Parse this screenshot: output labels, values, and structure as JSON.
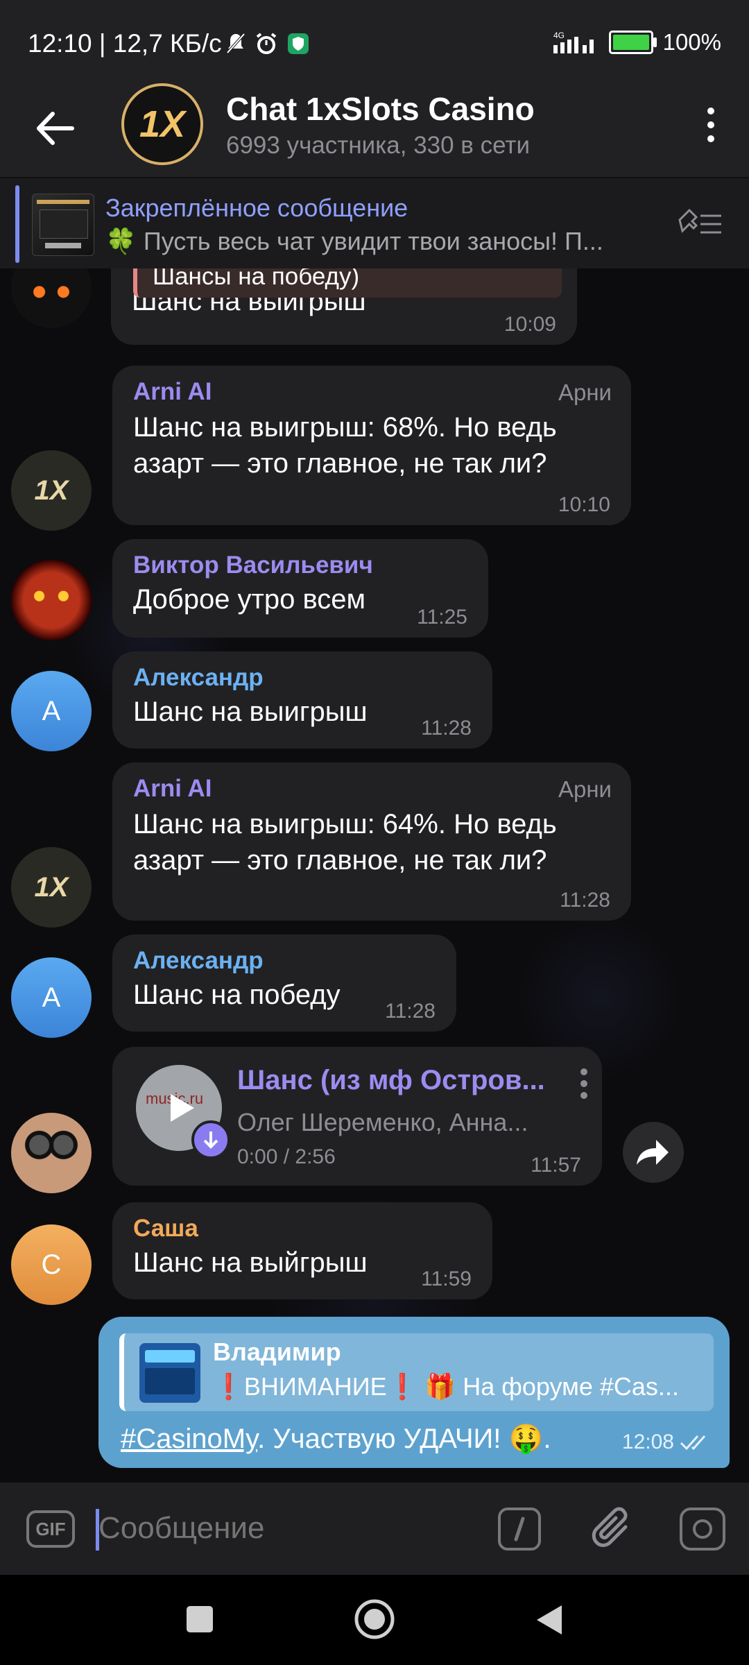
{
  "status": {
    "time": "12:10 | 12,7 КБ/с",
    "network": "4G",
    "battery": "100%"
  },
  "header": {
    "title": "Chat 1xSlots Casino",
    "subtitle": "6993 участника, 330 в сети",
    "avatar_text": "1X"
  },
  "pinned": {
    "title": "Закреплённое сообщение",
    "text": "🍀 Пусть весь чат увидит твои заносы! П..."
  },
  "messages": [
    {
      "reply_fragment": "Шансы на победу)",
      "text": "Шанс на выигрыш",
      "time": "10:09"
    },
    {
      "author": "Arni AI",
      "rank": "Арни",
      "text_line1": "Шанс на выигрыш: 68%. Но ведь",
      "text_line2": "азарт — это главное, не так ли?",
      "time": "10:10"
    },
    {
      "author": "Виктор Васильевич",
      "text": "Доброе утро всем",
      "time": "11:25"
    },
    {
      "author": "Александр",
      "avatar_letter": "A",
      "text": "Шанс на выигрыш",
      "time": "11:28"
    },
    {
      "author": "Arni AI",
      "rank": "Арни",
      "text_line1": "Шанс на выигрыш: 64%. Но ведь",
      "text_line2": "азарт — это главное, не так ли?",
      "time": "11:28"
    },
    {
      "author": "Александр",
      "avatar_letter": "A",
      "text": "Шанс на победу",
      "time": "11:28"
    },
    {
      "audio_title": "Шанс (из мф Остров...",
      "audio_artist": "Олег Шеременко, Анна...",
      "audio_progress": "0:00 / 2:56",
      "thumb_text": "music.ru",
      "time": "11:57"
    },
    {
      "author": "Саша",
      "avatar_letter": "С",
      "text": "Шанс на выйгрыш",
      "time": "11:59"
    }
  ],
  "own_message": {
    "quote_author": "Владимир",
    "quote_text": "❗ВНИМАНИЕ❗ 🎁 На форуме #Cas...",
    "hashtag": "#CasinoMy",
    "text": ". Участвую УДАЧИ! 🤑.",
    "time": "12:08"
  },
  "composer": {
    "placeholder": "Сообщение",
    "gif_label": "GIF"
  },
  "colors": {
    "accent": "#7b8cf0",
    "own_bubble": "#5da2cf",
    "name_violet": "#9b8cf0",
    "name_blue": "#6cb1f2",
    "name_orange": "#f3a95a"
  }
}
